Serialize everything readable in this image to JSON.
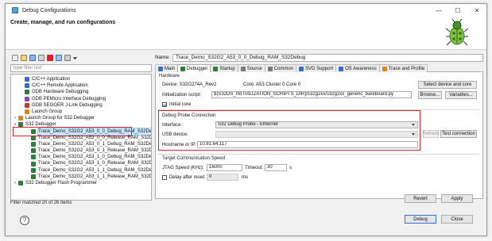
{
  "window": {
    "title": "Debug Configurations",
    "controls": [
      "—",
      "☐",
      "✕"
    ],
    "icon": "debug-configurations-icon"
  },
  "header": {
    "heading": "Create, manage, and run configurations"
  },
  "left": {
    "filter_placeholder": "type filter text",
    "toolbar_icons": [
      "new-config-icon",
      "new-prototype-icon",
      "export-icon",
      "duplicate-icon",
      "delete-icon",
      "filter-icon",
      "collapse-icon",
      "view-menu-icon"
    ],
    "tree": [
      {
        "label": "C/C++ Application",
        "indent": 1,
        "icon": "c-app-icon",
        "color": "#3a6bc4",
        "twist": ""
      },
      {
        "label": "C/C++ Remote Application",
        "indent": 1,
        "icon": "c-remote-icon",
        "color": "#3a6bc4",
        "twist": ""
      },
      {
        "label": "GDB Hardware Debugging",
        "indent": 1,
        "icon": "gdb-hw-icon",
        "color": "#2e7d3c",
        "twist": ""
      },
      {
        "label": "GDB PEMicro Interface Debugging",
        "indent": 1,
        "icon": "pemicro-icon",
        "color": "#8a4bb0",
        "twist": ""
      },
      {
        "label": "GDB SEGGER J-Link Debugging",
        "indent": 1,
        "icon": "segger-icon",
        "color": "#c0392b",
        "twist": ""
      },
      {
        "label": "Launch Group",
        "indent": 1,
        "icon": "launch-group-icon",
        "color": "#d68a1c",
        "twist": ""
      },
      {
        "label": "Launch Group for S32 Debugger",
        "indent": 0,
        "icon": "launch-group-s32-icon",
        "color": "#d68a1c",
        "twist": ">"
      },
      {
        "label": "S32 Debugger",
        "indent": 0,
        "icon": "s32-debugger-icon",
        "color": "#2e7d3c",
        "twist": "v"
      },
      {
        "label": "Trace_Demo_S32G2_A53_0_0_Debug_RAM_S32Debug",
        "indent": 2,
        "icon": "config-icon",
        "color": "#2e7d3c",
        "twist": "",
        "selected": true
      },
      {
        "label": "Trace_Demo_S32G2_A53_0_0_Release_RAM_S32Debug",
        "indent": 2,
        "icon": "config-icon",
        "color": "#2e7d3c",
        "twist": ""
      },
      {
        "label": "Trace_Demo_S32G2_A53_0_1_Debug_RAM_S32Debug",
        "indent": 2,
        "icon": "config-icon",
        "color": "#2e7d3c",
        "twist": ""
      },
      {
        "label": "Trace_Demo_S32G2_A53_0_1_Release_RAM_S32Debug",
        "indent": 2,
        "icon": "config-icon",
        "color": "#2e7d3c",
        "twist": ""
      },
      {
        "label": "Trace_Demo_S32G2_A53_1_0_Debug_RAM_S32Debug",
        "indent": 2,
        "icon": "config-icon",
        "color": "#2e7d3c",
        "twist": ""
      },
      {
        "label": "Trace_Demo_S32G2_A53_1_0_Release_RAM_S32Debug",
        "indent": 2,
        "icon": "config-icon",
        "color": "#2e7d3c",
        "twist": ""
      },
      {
        "label": "Trace_Demo_S32G2_A53_1_1_Debug_RAM_S32Debug",
        "indent": 2,
        "icon": "config-icon",
        "color": "#2e7d3c",
        "twist": ""
      },
      {
        "label": "Trace_Demo_S32G2_A53_1_1_Release_RAM_S32Debug",
        "indent": 2,
        "icon": "config-icon",
        "color": "#2e7d3c",
        "twist": ""
      },
      {
        "label": "S32 Debugger Flash Programmer",
        "indent": 0,
        "icon": "flash-programmer-icon",
        "color": "#2e7d3c",
        "twist": ">"
      }
    ],
    "status": "Filter matched 20 of 26 items"
  },
  "right": {
    "name_label": "Name:",
    "name_value": "Trace_Demo_S32G2_A53_0_0_Debug_RAM_S32Debug",
    "tabs": [
      {
        "label": "Main",
        "icon": "main-tab-icon",
        "color": "#3a6bc4",
        "active": false
      },
      {
        "label": "Debugger",
        "icon": "debugger-tab-icon",
        "color": "#2e7d3c",
        "active": true
      },
      {
        "label": "Startup",
        "icon": "startup-tab-icon",
        "color": "#2e7d3c",
        "active": false
      },
      {
        "label": "Source",
        "icon": "source-tab-icon",
        "color": "#7a7a7a",
        "active": false
      },
      {
        "label": "Common",
        "icon": "common-tab-icon",
        "color": "#7a7a7a",
        "active": false
      },
      {
        "label": "SVD Support",
        "icon": "svd-tab-icon",
        "color": "#3a6bc4",
        "active": false
      },
      {
        "label": "OS Awareness",
        "icon": "os-tab-icon",
        "color": "#3a6bc4",
        "active": false
      },
      {
        "label": "Trace and Profile",
        "icon": "trace-tab-icon",
        "color": "#d68a1c",
        "active": false
      }
    ],
    "hardware": {
      "title": "Hardware",
      "device": "Device: S32G274A_Rev2",
      "core": "Core: A53 Cluster 0 Core 0",
      "select_button": "Select device and core",
      "init_label": "Initialization script:",
      "init_value": "${S32DS_INITIALIZATION_SCRIPTS_DIR}/s32g2xx/s32g2xx_generic_bareboard.py",
      "browse_button": "Browse...",
      "variables_button": "Variables...",
      "initial_core_label": "Initial core",
      "initial_core_checked": true
    },
    "probe": {
      "title": "Debug Probe Connection",
      "interface_label": "Interface:",
      "interface_value": "S32 Debug Probe - Ethernet",
      "usb_label": "USB device:",
      "usb_value": "",
      "refresh_button": "Refresh",
      "hostname_label": "Hostname or IP:",
      "hostname_value": "10.81.64.117",
      "test_button": "Test connection"
    },
    "speed": {
      "title": "Target Communication Speed",
      "jtag_label": "JTAG Speed (KHz):",
      "jtag_value": "16000",
      "timeout_label": "Timeout:",
      "timeout_value": "30",
      "timeout_unit": "s",
      "delay_label": "Delay after reset:",
      "delay_value": "0",
      "delay_unit": "ms",
      "delay_checked": false
    },
    "revert_button": "Revert",
    "apply_button": "Apply"
  },
  "footer": {
    "help": "?",
    "debug_button": "Debug",
    "close_button": "Close"
  },
  "colors": {
    "highlight_red": "#d9232e",
    "selection_blue": "#cce8ff"
  }
}
